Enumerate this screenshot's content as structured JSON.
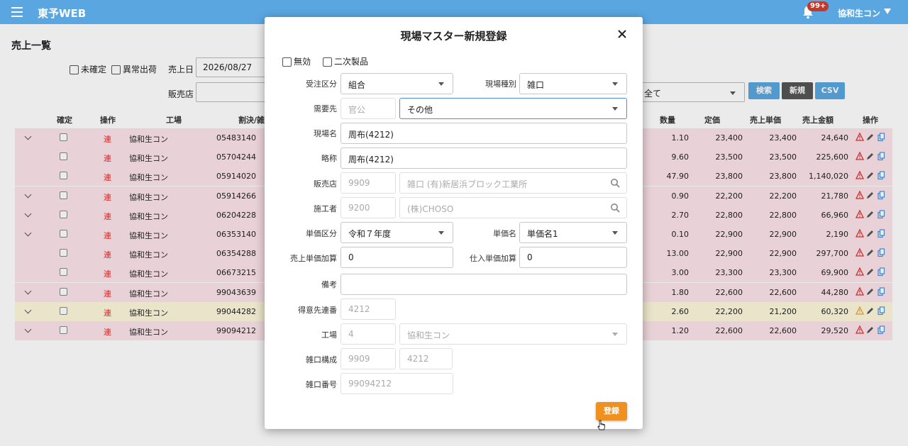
{
  "header": {
    "app_title": "東予WEB",
    "notification_badge": "99+",
    "user_name": "協和生コン"
  },
  "page": {
    "title": "売上一覧",
    "filters": {
      "unconfirmed_label": "未確定",
      "abnormal_label": "異常出荷",
      "sales_date_label": "売上日",
      "sales_date_value": "2026/08/27",
      "dealer_label": "販売店",
      "select_value": "全て"
    },
    "buttons": {
      "search": "検索",
      "new": "新規",
      "csv": "CSV"
    },
    "columns": {
      "confirm": "確定",
      "operation": "操作",
      "factory": "工場",
      "split": "割決/雑口",
      "quantity": "数量",
      "list_price": "定価",
      "unit_price": "売上単価",
      "amount": "売上金額",
      "actions": "操作"
    },
    "rows": [
      {
        "chevron": true,
        "op": "連",
        "factory": "協和生コン",
        "code": "05483140",
        "qty": "1.10",
        "list": "23,400",
        "unit": "23,400",
        "amount": "24,640",
        "color": "pink",
        "warn": "red"
      },
      {
        "chevron": false,
        "op": "連",
        "factory": "協和生コン",
        "code": "05704244",
        "qty": "9.60",
        "list": "23,500",
        "unit": "23,500",
        "amount": "225,600",
        "color": "pink",
        "warn": "red"
      },
      {
        "chevron": false,
        "op": "連",
        "factory": "協和生コン",
        "code": "05914020",
        "qty": "47.90",
        "list": "23,800",
        "unit": "23,800",
        "amount": "1,140,020",
        "color": "pink",
        "warn": "red"
      },
      {
        "chevron": true,
        "op": "連",
        "factory": "協和生コン",
        "code": "05914266",
        "qty": "0.90",
        "list": "22,200",
        "unit": "22,200",
        "amount": "21,780",
        "color": "pink",
        "warn": "red"
      },
      {
        "chevron": true,
        "op": "連",
        "factory": "協和生コン",
        "code": "06204228",
        "qty": "2.70",
        "list": "22,800",
        "unit": "22,800",
        "amount": "66,960",
        "color": "pink",
        "warn": "red"
      },
      {
        "chevron": true,
        "op": "連",
        "factory": "協和生コン",
        "code": "06353140",
        "qty": "0.10",
        "list": "22,900",
        "unit": "22,900",
        "amount": "2,190",
        "color": "pink",
        "warn": "red"
      },
      {
        "chevron": false,
        "op": "連",
        "factory": "協和生コン",
        "code": "06354288",
        "qty": "13.00",
        "list": "22,900",
        "unit": "22,900",
        "amount": "297,700",
        "color": "pink",
        "warn": "red"
      },
      {
        "chevron": false,
        "op": "連",
        "factory": "協和生コン",
        "code": "06673215",
        "qty": "3.00",
        "list": "23,300",
        "unit": "23,300",
        "amount": "69,900",
        "color": "pink",
        "warn": "red"
      },
      {
        "chevron": true,
        "op": "連",
        "factory": "協和生コン",
        "code": "99043639",
        "qty": "1.80",
        "list": "22,600",
        "unit": "22,600",
        "amount": "44,280",
        "color": "pink",
        "warn": "red"
      },
      {
        "chevron": true,
        "op": "連",
        "factory": "協和生コン",
        "code": "99044282",
        "qty": "2.60",
        "list": "22,200",
        "unit": "21,200",
        "amount": "60,320",
        "color": "yellow",
        "warn": "orange"
      },
      {
        "chevron": true,
        "op": "連",
        "factory": "協和生コン",
        "code": "99094212",
        "qty": "1.20",
        "list": "22,600",
        "unit": "22,600",
        "amount": "29,520",
        "color": "pink",
        "warn": "red"
      }
    ]
  },
  "modal": {
    "title": "現場マスター新規登録",
    "invalid_label": "無効",
    "secondary_product_label": "二次製品",
    "order_type_label": "受注区分",
    "order_type_value": "組合",
    "site_type_label": "現場種別",
    "site_type_value": "雑口",
    "demand_label": "需要先",
    "demand_code": "官公",
    "demand_value": "その他",
    "site_name_label": "現場名",
    "site_name_value": "周布(4212)",
    "short_name_label": "略称",
    "short_name_value": "周布(4212)",
    "dealer_label": "販売店",
    "dealer_code": "9909",
    "dealer_name": "雑口 (有)新居浜ブロック工業所",
    "contractor_label": "施工者",
    "contractor_code": "9200",
    "contractor_name": "(株)CHOSO",
    "price_class_label": "単価区分",
    "price_class_value": "令和７年度",
    "price_name_label": "単価名",
    "price_name_value": "単価名1",
    "sales_add_label": "売上単価加算",
    "sales_add_value": "0",
    "purchase_add_label": "仕入単価加算",
    "purchase_add_value": "0",
    "remarks_label": "備考",
    "remarks_value": "",
    "customer_serial_label": "得意先連番",
    "customer_serial_value": "4212",
    "factory_label": "工場",
    "factory_code": "4",
    "factory_name": "協和生コン",
    "misc_config_label": "雑口構成",
    "misc_config_a": "9909",
    "misc_config_b": "4212",
    "misc_number_label": "雑口番号",
    "misc_number_value": "99094212",
    "submit_label": "登録"
  },
  "colors": {
    "header_bg": "#5aa6e0",
    "row_pink": "#fde4ea",
    "row_yellow": "#fdf8dc",
    "btn_blue": "#5aa6e0",
    "btn_gray": "#555555",
    "submit_orange": "#f0901e"
  }
}
